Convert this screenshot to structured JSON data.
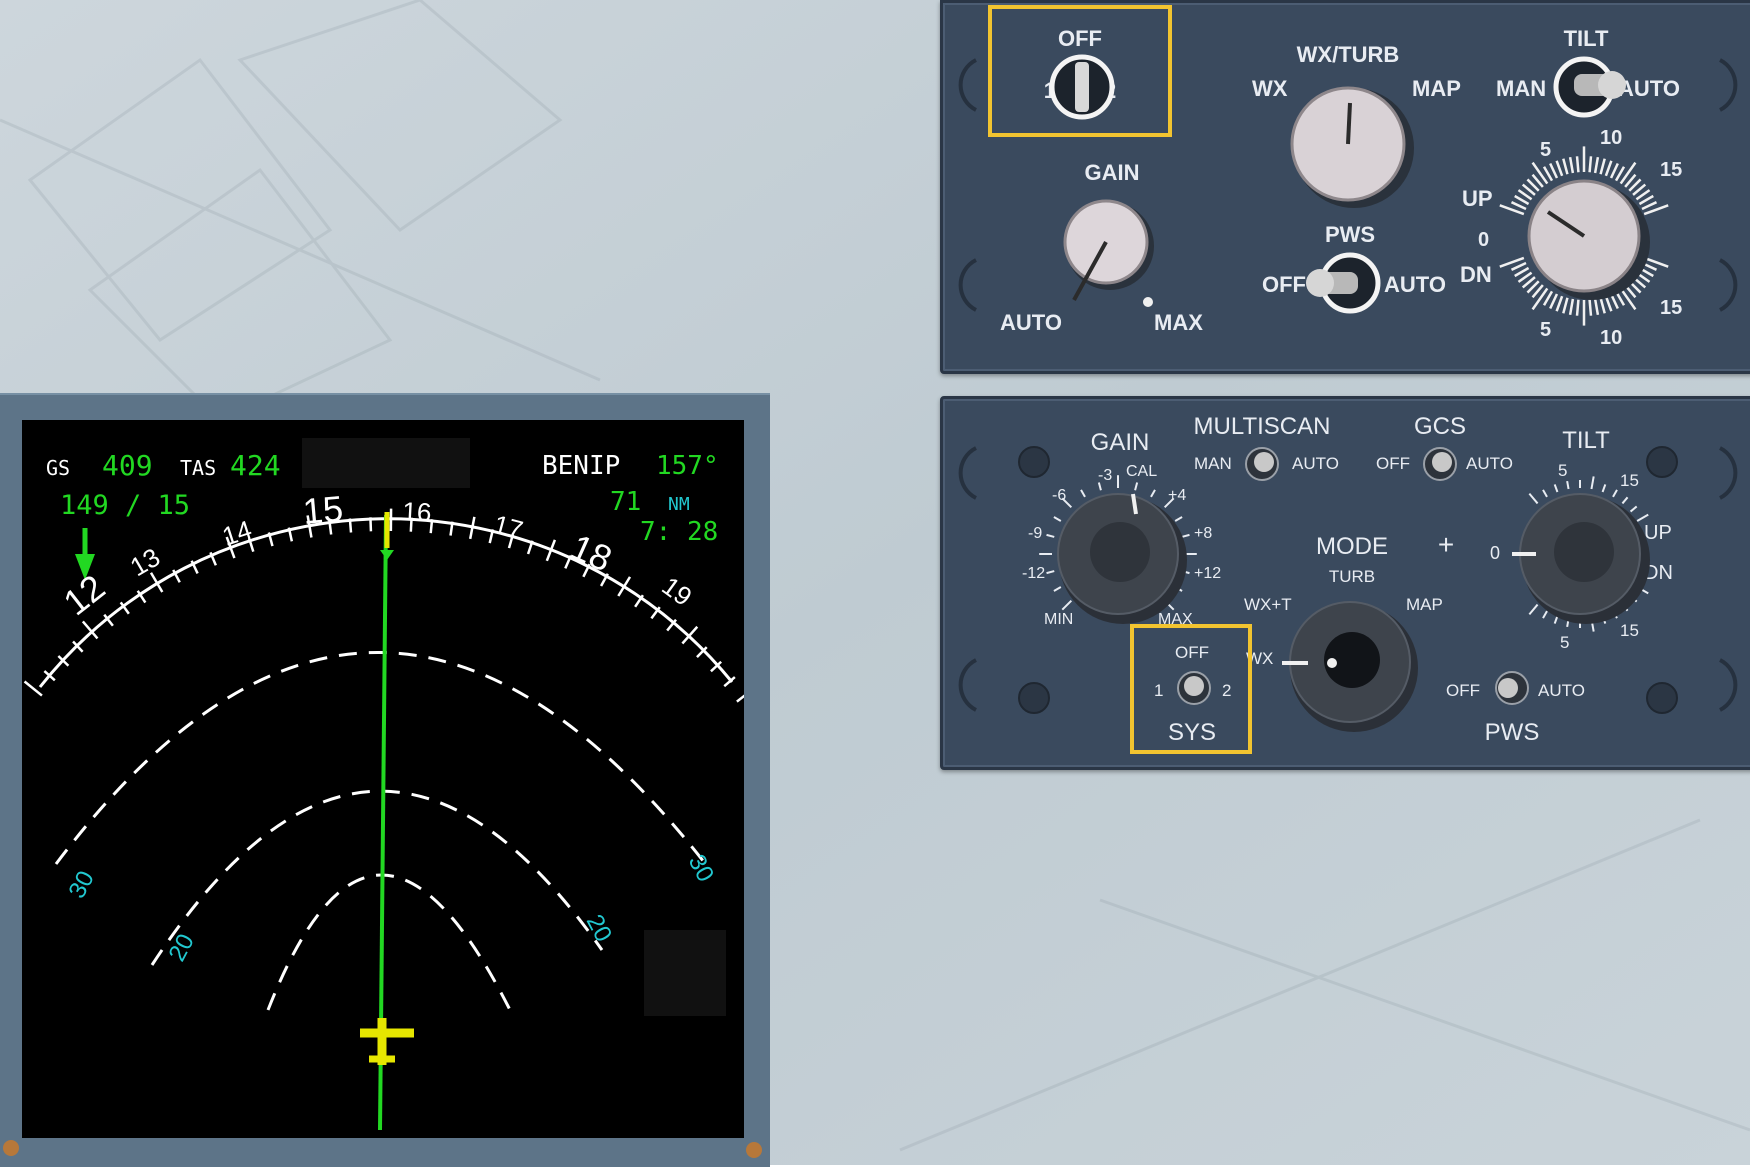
{
  "colors": {
    "accent_yellow": "#f2c430",
    "nd_green": "#22d822",
    "nd_cyan": "#22c8d0",
    "nd_white": "#ffffff",
    "panel_bg": "#3a4a5e",
    "panel_text": "#e8ecf2"
  },
  "nd": {
    "gs_label": "GS",
    "gs_value": "409",
    "tas_label": "TAS",
    "tas_value": "424",
    "wind": "149 / 15",
    "waypoint": "BENIP",
    "bearing": "157°",
    "distance_value": "71",
    "distance_unit": "NM",
    "eta": "7: 28",
    "heading_labels": [
      "12",
      "13",
      "14",
      "15",
      "16",
      "17",
      "18",
      "19"
    ],
    "range_labels_left": [
      "30",
      "20"
    ],
    "range_labels_right": [
      "30",
      "20"
    ],
    "icons": [
      "wind-arrow-icon",
      "aircraft-symbol-icon"
    ]
  },
  "upper_panel": {
    "sys_off": "OFF",
    "sys_1": "1",
    "sys_2": "2",
    "mode_title": "WX/TURB",
    "mode_wx": "WX",
    "mode_map": "MAP",
    "tilt_title": "TILT",
    "tilt_man": "MAN",
    "tilt_auto": "AUTO",
    "tilt_ticks": [
      "5",
      "10",
      "15",
      "UP",
      "0",
      "DN",
      "5",
      "10",
      "15"
    ],
    "gain_title": "GAIN",
    "gain_auto": "AUTO",
    "gain_max": "MAX",
    "pws_title": "PWS",
    "pws_off": "OFF",
    "pws_auto": "AUTO"
  },
  "lower_panel": {
    "gain_title": "GAIN",
    "gain_scale": [
      "-3",
      "CAL",
      "-6",
      "+4",
      "-9",
      "+8",
      "-12",
      "+12",
      "MIN",
      "MAX"
    ],
    "multiscan_title": "MULTISCAN",
    "multiscan_man": "MAN",
    "multiscan_auto": "AUTO",
    "gcs_title": "GCS",
    "gcs_off": "OFF",
    "gcs_auto": "AUTO",
    "tilt_title": "TILT",
    "tilt_scale": [
      "5",
      "15",
      "UP",
      "0",
      "DN",
      "5",
      "15"
    ],
    "mode_title": "MODE",
    "mode_turb": "TURB",
    "mode_wxt": "WX+T",
    "mode_map": "MAP",
    "mode_wx": "WX",
    "sys_off": "OFF",
    "sys_1": "1",
    "sys_2": "2",
    "sys_title": "SYS",
    "pws_off": "OFF",
    "pws_auto": "AUTO",
    "pws_title": "PWS"
  }
}
